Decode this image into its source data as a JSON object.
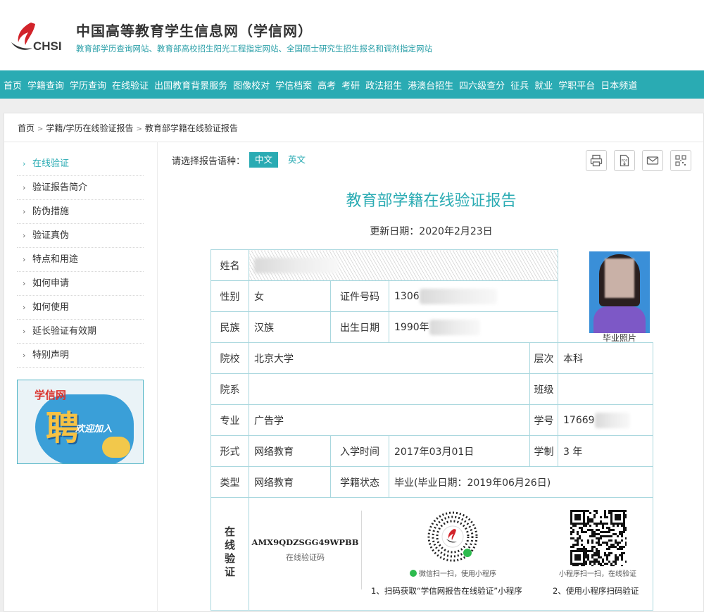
{
  "header": {
    "logo_text": "CHSI",
    "title": "中国高等教育学生信息网（学信网）",
    "subtitle": "教育部学历查询网站、教育部高校招生阳光工程指定网站、全国硕士研究生招生报名和调剂指定网站"
  },
  "nav": [
    "首页",
    "学籍查询",
    "学历查询",
    "在线验证",
    "出国教育背景服务",
    "图像校对",
    "学信档案",
    "高考",
    "考研",
    "政法招生",
    "港澳台招生",
    "四六级查分",
    "征兵",
    "就业",
    "学职平台",
    "日本频道"
  ],
  "breadcrumb": [
    "首页",
    "学籍/学历在线验证报告",
    "教育部学籍在线验证报告"
  ],
  "sidebar": {
    "items": [
      "在线验证",
      "验证报告简介",
      "防伪措施",
      "验证真伪",
      "特点和用途",
      "如何申请",
      "如何使用",
      "延长验证有效期",
      "特别声明"
    ],
    "active_index": 0
  },
  "banner": {
    "logo": "学信网",
    "big": "聘",
    "welcome": "欢迎加入"
  },
  "lang": {
    "prompt": "请选择报告语种：",
    "zh": "中文",
    "en": "英文"
  },
  "tools": [
    "print-icon",
    "pdf-icon",
    "mail-icon",
    "qrcode-icon"
  ],
  "report": {
    "title": "教育部学籍在线验证报告",
    "update_date": "更新日期：2020年2月23日",
    "labels": {
      "name": "姓名",
      "gender": "性别",
      "id": "证件号码",
      "ethnicity": "民族",
      "birth": "出生日期",
      "school": "院校",
      "level": "层次",
      "dept": "院系",
      "class": "班级",
      "major": "专业",
      "student_no": "学号",
      "form": "形式",
      "enroll": "入学时间",
      "duration": "学制",
      "type": "类型",
      "status": "学籍状态",
      "verify": "在线验证"
    },
    "values": {
      "gender": "女",
      "id": "1306",
      "ethnicity": "汉族",
      "birth": "1990年",
      "school": "北京大学",
      "level": "本科",
      "dept": "",
      "class": "",
      "major": "广告学",
      "student_no": "17669",
      "form": "网络教育",
      "enroll": "2017年03月01日",
      "duration": "3 年",
      "type": "网络教育",
      "status": "毕业(毕业日期：2019年06月26日)"
    },
    "photo_label": "毕业照片",
    "verify_code": "AMX9QDZSGG49WPBB",
    "verify_code_label": "在线验证码",
    "mini_caption": "微信扫一扫，使用小程序",
    "qr_caption": "小程序扫一扫，在线验证",
    "step1": "1、扫码获取“学信网报告在线验证”小程序",
    "step2": "2、使用小程序扫码验证"
  },
  "colors": {
    "accent": "#2aabb3",
    "table_border": "#a9d7de"
  }
}
